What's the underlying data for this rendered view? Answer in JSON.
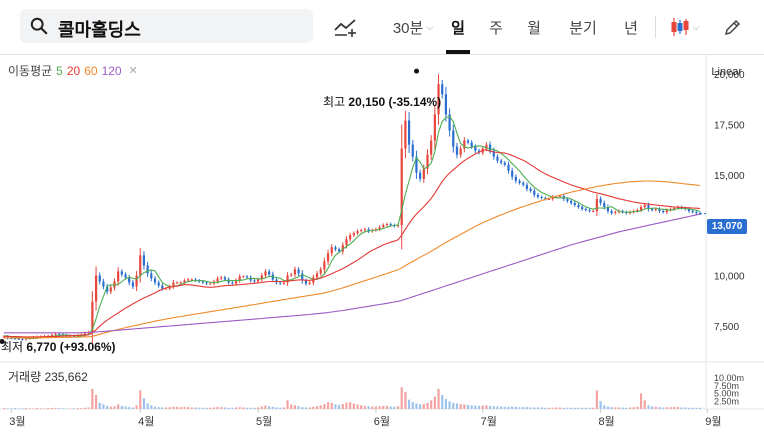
{
  "header": {
    "search_text": "콜마홀딩스",
    "interval": "30분",
    "tabs": [
      "일",
      "주",
      "월",
      "분기",
      "년"
    ],
    "active_tab": "일"
  },
  "legend": {
    "title": "이동평균",
    "ma": [
      {
        "label": "5",
        "color": "#4caf50"
      },
      {
        "label": "20",
        "color": "#e53935"
      },
      {
        "label": "60",
        "color": "#ef8a2a"
      },
      {
        "label": "120",
        "color": "#9c5bc4"
      }
    ]
  },
  "scale_mode": "Linear",
  "annotations": {
    "high": {
      "prefix": "최고 ",
      "value": "20,150",
      "pct": "(-35.14%)"
    },
    "low": {
      "prefix": "최저 ",
      "value": "6,770",
      "pct": "(+93.06%)"
    }
  },
  "current_price": "13,070",
  "volume_label": "거래량 235,662",
  "chart_data": {
    "type": "candlestick",
    "y_axis": {
      "min": 6000,
      "max": 21000,
      "ticks": [
        "20,000",
        "17,500",
        "15,000",
        "12,500",
        "10,000",
        "7,500"
      ],
      "tick_values": [
        20000,
        17500,
        15000,
        12500,
        10000,
        7500
      ]
    },
    "volume_axis": {
      "ticks": [
        "10.00m",
        "7.50m",
        "5.00m",
        "2.50m"
      ]
    },
    "x_axis": {
      "labels": [
        "3월",
        "4월",
        "5월",
        "6월",
        "7월",
        "8월",
        "9월"
      ]
    },
    "colors": {
      "up": "#e8453c",
      "down": "#2a6fd0",
      "vol_up": "#f4a3a3",
      "vol_down": "#9cc3ee"
    },
    "close_series": [
      6960,
      6900,
      6880,
      6870,
      6850,
      6830,
      6880,
      6900,
      6930,
      6950,
      6960,
      6980,
      7000,
      7050,
      7100,
      7080,
      7030,
      6990,
      7000,
      6980,
      7010,
      7050,
      7120,
      7180,
      8700,
      10000,
      9700,
      9450,
      9200,
      9400,
      9700,
      10200,
      10050,
      9900,
      9650,
      9450,
      10000,
      11000,
      10500,
      10100,
      9850,
      9650,
      9500,
      9350,
      9350,
      9450,
      9650,
      9650,
      9650,
      9750,
      9800,
      9800,
      9750,
      9700,
      9650,
      9600,
      9600,
      9700,
      9850,
      9900,
      9800,
      9650,
      9600,
      9750,
      9950,
      9950,
      9900,
      9750,
      9700,
      9800,
      10000,
      10200,
      10050,
      9800,
      9650,
      9600,
      9650,
      10000,
      10050,
      10300,
      10100,
      9750,
      9600,
      9650,
      9900,
      10100,
      10300,
      10700,
      11100,
      11400,
      11300,
      11200,
      11500,
      11800,
      12000,
      12100,
      12200,
      12250,
      12300,
      12200,
      12250,
      12300,
      12400,
      12500,
      12550,
      12500,
      12450,
      12500,
      16300,
      17700,
      16500,
      15900,
      15100,
      14800,
      15300,
      16000,
      16700,
      18000,
      19500,
      19000,
      18000,
      17200,
      16400,
      16000,
      16300,
      16700,
      16600,
      16400,
      16200,
      16100,
      16300,
      16500,
      16200,
      15900,
      15700,
      15600,
      15500,
      15200,
      14900,
      14700,
      14600,
      14500,
      14300,
      14200,
      14000,
      13900,
      13850,
      13800,
      13800,
      13900,
      13900,
      13950,
      13800,
      13700,
      13600,
      13500,
      13400,
      13300,
      13250,
      13200,
      13200,
      13800,
      13600,
      13400,
      13200,
      13100,
      13150,
      13200,
      13150,
      13100,
      13150,
      13200,
      13250,
      13400,
      13500,
      13300,
      13250,
      13300,
      13200,
      13150,
      13250,
      13300,
      13350,
      13400,
      13350,
      13300,
      13200,
      13150,
      13100,
      13070
    ],
    "ma_series": {
      "ma5": [
        7010,
        6990,
        6960,
        6940,
        6920,
        6900,
        6880,
        6870,
        6870,
        6880,
        6910,
        6940,
        6960,
        6980,
        7000,
        7030,
        7040,
        7040,
        7030,
        7010,
        7000,
        7000,
        7030,
        7060,
        7320,
        7860,
        8460,
        8960,
        9440,
        9540,
        9510,
        9560,
        9690,
        9840,
        9910,
        9870,
        9810,
        9980,
        10140,
        10210,
        10280,
        10230,
        9930,
        9650,
        9530,
        9440,
        9450,
        9490,
        9550,
        9630,
        9690,
        9730,
        9750,
        9750,
        9740,
        9710,
        9660,
        9650,
        9660,
        9710,
        9750,
        9760,
        9750,
        9740,
        9760,
        9780,
        9830,
        9850,
        9860,
        9830,
        9830,
        9880,
        9950,
        9950,
        9900,
        9860,
        9750,
        9740,
        9790,
        9860,
        9940,
        10040,
        9960,
        9880,
        9800,
        9800,
        9910,
        10070,
        10360,
        10720,
        11000,
        11140,
        11300,
        11440,
        11560,
        11720,
        11920,
        12070,
        12170,
        12210,
        12240,
        12260,
        12290,
        12330,
        12400,
        12450,
        12480,
        12500,
        13240,
        14050,
        14690,
        15380,
        15830,
        15640,
        15300,
        15380,
        15580,
        16160,
        17100,
        17640,
        17840,
        17900,
        17640,
        17060,
        16560,
        16400,
        16330,
        16380,
        16410,
        16440,
        16410,
        16330,
        16290,
        16250,
        16180,
        16060,
        15920,
        15760,
        15550,
        15370,
        15190,
        14960,
        14760,
        14560,
        14380,
        14250,
        14120,
        14040,
        13960,
        13880,
        13860,
        13860,
        13860,
        13860,
        13800,
        13710,
        13620,
        13510,
        13410,
        13340,
        13290,
        13350,
        13350,
        13340,
        13370,
        13420,
        13300,
        13170,
        13150,
        13140,
        13140,
        13160,
        13180,
        13220,
        13300,
        13330,
        13330,
        13350,
        13300,
        13290,
        13260,
        13240,
        13270,
        13320,
        13340,
        13320,
        13300,
        13270,
        13240,
        13180
      ],
      "ma20": [
        6980,
        6975,
        6970,
        6965,
        6960,
        6955,
        6950,
        6950,
        6950,
        6950,
        6955,
        6960,
        6965,
        6970,
        6975,
        6980,
        6990,
        7000,
        7010,
        7020,
        7030,
        7040,
        7050,
        7060,
        7140,
        7300,
        7480,
        7640,
        7780,
        7900,
        8020,
        8140,
        8260,
        8380,
        8480,
        8590,
        8690,
        8790,
        8880,
        8960,
        9050,
        9130,
        9240,
        9310,
        9380,
        9430,
        9440,
        9470,
        9510,
        9540,
        9540,
        9530,
        9490,
        9470,
        9440,
        9420,
        9410,
        9420,
        9440,
        9470,
        9490,
        9500,
        9510,
        9530,
        9540,
        9560,
        9580,
        9590,
        9610,
        9630,
        9650,
        9680,
        9700,
        9700,
        9700,
        9700,
        9710,
        9720,
        9740,
        9760,
        9780,
        9780,
        9760,
        9760,
        9780,
        9830,
        9870,
        9930,
        10010,
        10090,
        10170,
        10250,
        10340,
        10440,
        10550,
        10650,
        10760,
        10880,
        11010,
        11140,
        11250,
        11340,
        11430,
        11520,
        11590,
        11650,
        11700,
        11770,
        12000,
        12300,
        12580,
        12840,
        13050,
        13230,
        13410,
        13610,
        13830,
        14090,
        14380,
        14660,
        14900,
        15090,
        15250,
        15400,
        15560,
        15700,
        15820,
        15930,
        16040,
        16120,
        16220,
        16240,
        16170,
        16130,
        16110,
        16100,
        16080,
        16030,
        15960,
        15880,
        15800,
        15720,
        15620,
        15500,
        15380,
        15260,
        15150,
        15050,
        14960,
        14880,
        14800,
        14720,
        14640,
        14570,
        14500,
        14440,
        14380,
        14330,
        14270,
        14200,
        14140,
        14100,
        14060,
        14010,
        13960,
        13910,
        13860,
        13810,
        13770,
        13730,
        13690,
        13650,
        13620,
        13590,
        13570,
        13540,
        13520,
        13500,
        13480,
        13460,
        13440,
        13420,
        13400,
        13390,
        13380,
        13370,
        13360,
        13350,
        13340,
        13330
      ],
      "ma60": [
        6900,
        6900,
        6900,
        6900,
        6900,
        6900,
        6900,
        6900,
        6900,
        6900,
        6905,
        6910,
        6910,
        6915,
        6920,
        6920,
        6925,
        6930,
        6930,
        6935,
        6940,
        6945,
        6950,
        6955,
        6980,
        7030,
        7080,
        7130,
        7180,
        7220,
        7270,
        7320,
        7360,
        7410,
        7450,
        7490,
        7530,
        7570,
        7610,
        7650,
        7690,
        7730,
        7770,
        7800,
        7840,
        7870,
        7900,
        7930,
        7960,
        7990,
        8020,
        8050,
        8080,
        8110,
        8140,
        8170,
        8200,
        8230,
        8260,
        8290,
        8320,
        8350,
        8380,
        8410,
        8440,
        8470,
        8500,
        8530,
        8560,
        8590,
        8620,
        8650,
        8680,
        8710,
        8740,
        8770,
        8800,
        8830,
        8860,
        8890,
        8920,
        8950,
        8980,
        9010,
        9040,
        9070,
        9100,
        9140,
        9180,
        9230,
        9280,
        9330,
        9380,
        9440,
        9500,
        9560,
        9620,
        9680,
        9740,
        9800,
        9860,
        9920,
        9980,
        10040,
        10100,
        10160,
        10220,
        10280,
        10380,
        10490,
        10600,
        10700,
        10800,
        10900,
        11000,
        11100,
        11200,
        11310,
        11420,
        11530,
        11640,
        11740,
        11840,
        11940,
        12040,
        12140,
        12240,
        12340,
        12440,
        12530,
        12620,
        12700,
        12780,
        12860,
        12940,
        13010,
        13080,
        13150,
        13220,
        13290,
        13360,
        13420,
        13480,
        13540,
        13600,
        13660,
        13720,
        13780,
        13840,
        13890,
        13940,
        13990,
        14040,
        14090,
        14140,
        14180,
        14220,
        14260,
        14300,
        14340,
        14380,
        14420,
        14450,
        14480,
        14510,
        14540,
        14570,
        14590,
        14610,
        14630,
        14650,
        14660,
        14670,
        14680,
        14690,
        14690,
        14690,
        14680,
        14670,
        14660,
        14650,
        14630,
        14610,
        14590,
        14570,
        14550,
        14530,
        14510,
        14490,
        14470
      ],
      "ma120": [
        7150,
        7150,
        7150,
        7150,
        7150,
        7150,
        7150,
        7150,
        7150,
        7150,
        7150,
        7150,
        7150,
        7150,
        7150,
        7150,
        7150,
        7150,
        7150,
        7150,
        7150,
        7155,
        7160,
        7165,
        7175,
        7190,
        7205,
        7220,
        7235,
        7250,
        7265,
        7280,
        7295,
        7310,
        7325,
        7340,
        7355,
        7370,
        7385,
        7400,
        7415,
        7430,
        7445,
        7460,
        7475,
        7490,
        7505,
        7520,
        7535,
        7550,
        7565,
        7580,
        7595,
        7610,
        7625,
        7640,
        7655,
        7670,
        7685,
        7700,
        7715,
        7730,
        7745,
        7760,
        7775,
        7790,
        7805,
        7820,
        7835,
        7850,
        7865,
        7880,
        7895,
        7910,
        7925,
        7940,
        7955,
        7970,
        7985,
        8000,
        8015,
        8030,
        8045,
        8060,
        8080,
        8100,
        8120,
        8140,
        8160,
        8185,
        8210,
        8235,
        8260,
        8290,
        8320,
        8350,
        8380,
        8410,
        8440,
        8470,
        8500,
        8530,
        8560,
        8590,
        8620,
        8650,
        8680,
        8710,
        8760,
        8820,
        8880,
        8940,
        9000,
        9060,
        9120,
        9180,
        9240,
        9300,
        9360,
        9420,
        9480,
        9540,
        9600,
        9660,
        9720,
        9780,
        9840,
        9900,
        9960,
        10020,
        10080,
        10140,
        10200,
        10260,
        10320,
        10380,
        10440,
        10500,
        10560,
        10620,
        10680,
        10740,
        10800,
        10860,
        10920,
        10980,
        11040,
        11100,
        11160,
        11220,
        11280,
        11340,
        11400,
        11460,
        11520,
        11570,
        11620,
        11670,
        11720,
        11770,
        11820,
        11870,
        11920,
        11970,
        12020,
        12070,
        12120,
        12170,
        12210,
        12250,
        12290,
        12330,
        12370,
        12410,
        12450,
        12490,
        12530,
        12570,
        12610,
        12650,
        12690,
        12730,
        12770,
        12810,
        12850,
        12890,
        12930,
        12970,
        13010,
        13050
      ]
    },
    "volumes": [
      0.3,
      0.2,
      0.2,
      0.3,
      0.2,
      0.2,
      0.3,
      0.2,
      0.2,
      0.3,
      0.2,
      0.2,
      0.3,
      0.3,
      0.4,
      0.3,
      0.2,
      0.2,
      0.2,
      0.2,
      0.3,
      0.3,
      0.4,
      0.5,
      6.5,
      4.5,
      2.0,
      1.5,
      1.0,
      0.8,
      0.9,
      1.5,
      1.0,
      0.8,
      0.6,
      0.5,
      1.2,
      6.0,
      3.5,
      1.8,
      1.2,
      0.8,
      0.6,
      0.5,
      0.5,
      0.6,
      0.8,
      0.7,
      0.6,
      0.7,
      0.6,
      0.5,
      0.5,
      0.4,
      0.4,
      0.4,
      0.4,
      0.5,
      0.7,
      0.6,
      0.5,
      0.4,
      0.4,
      0.5,
      0.6,
      0.5,
      0.4,
      0.4,
      0.4,
      0.5,
      0.8,
      1.1,
      0.9,
      0.7,
      0.5,
      0.4,
      0.5,
      2.8,
      1.5,
      1.2,
      0.9,
      0.6,
      0.5,
      0.5,
      0.7,
      0.9,
      1.2,
      1.6,
      2.2,
      2.0,
      1.5,
      1.3,
      1.6,
      2.0,
      2.2,
      1.8,
      1.5,
      1.2,
      1.0,
      0.9,
      0.8,
      0.8,
      0.9,
      1.0,
      1.0,
      0.8,
      0.7,
      0.9,
      7.0,
      5.5,
      3.0,
      2.2,
      1.8,
      1.5,
      1.6,
      2.0,
      2.8,
      4.0,
      6.5,
      4.5,
      3.2,
      2.5,
      2.0,
      1.8,
      1.6,
      1.5,
      1.3,
      1.2,
      1.1,
      1.0,
      1.1,
      1.2,
      1.0,
      0.9,
      0.8,
      0.8,
      0.7,
      0.7,
      0.8,
      0.7,
      0.6,
      0.6,
      0.6,
      0.5,
      0.5,
      0.5,
      0.5,
      0.4,
      0.4,
      0.4,
      0.5,
      0.5,
      0.4,
      0.4,
      0.4,
      0.4,
      0.4,
      0.4,
      0.4,
      0.4,
      0.4,
      6.0,
      2.5,
      1.2,
      0.8,
      0.6,
      0.5,
      0.5,
      0.5,
      0.4,
      0.5,
      0.6,
      0.7,
      5.0,
      2.8,
      1.2,
      0.8,
      0.7,
      0.6,
      0.5,
      0.6,
      0.6,
      0.7,
      0.6,
      0.5,
      0.5,
      0.4,
      0.4,
      0.4,
      0.4
    ],
    "month_start_index": [
      2,
      37,
      69,
      101,
      130,
      162,
      191
    ]
  }
}
